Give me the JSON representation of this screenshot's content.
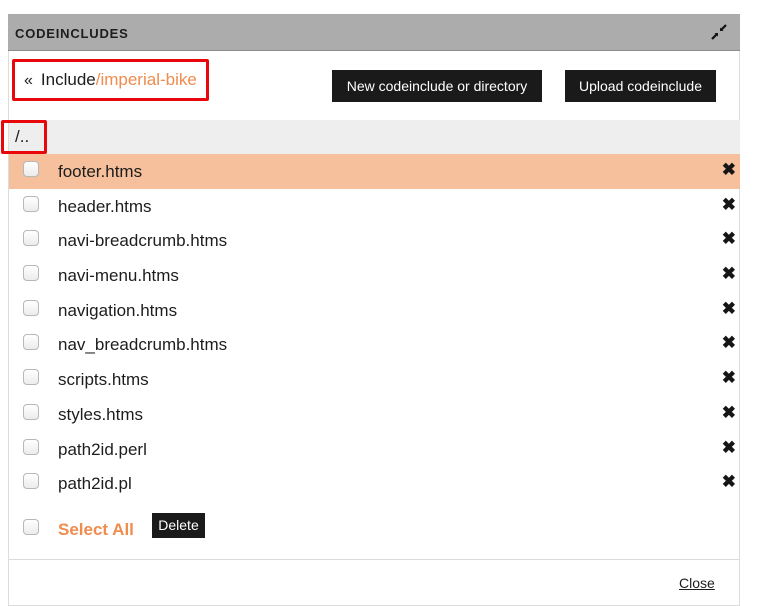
{
  "dialog": {
    "title": "CODEINCLUDES",
    "collapse_icon": "collapse-arrows-icon"
  },
  "breadcrumb": {
    "back_icon": "«",
    "root": "Include",
    "current": "/imperial-bike"
  },
  "toolbar": {
    "new_label": "New codeinclude or directory",
    "upload_label": "Upload codeinclude"
  },
  "parent_dir": {
    "label": "/.."
  },
  "files": [
    {
      "name": "footer.htms",
      "selected": true,
      "checked": false
    },
    {
      "name": "header.htms",
      "selected": false,
      "checked": false
    },
    {
      "name": "navi-breadcrumb.htms",
      "selected": false,
      "checked": false
    },
    {
      "name": "navi-menu.htms",
      "selected": false,
      "checked": false
    },
    {
      "name": "navigation.htms",
      "selected": false,
      "checked": false
    },
    {
      "name": "nav_breadcrumb.htms",
      "selected": false,
      "checked": false
    },
    {
      "name": "scripts.htms",
      "selected": false,
      "checked": false
    },
    {
      "name": "styles.htms",
      "selected": false,
      "checked": false
    },
    {
      "name": "path2id.perl",
      "selected": false,
      "checked": false
    },
    {
      "name": "path2id.pl",
      "selected": false,
      "checked": false
    }
  ],
  "delete_icon": "✖",
  "footer": {
    "select_all_label": "Select All",
    "delete_label": "Delete",
    "close_label": "Close"
  },
  "colors": {
    "accent": "#ef8c4e",
    "selected_row": "#f5c09b",
    "highlight_box": "#e8080c",
    "titlebar": "#acacac",
    "button": "#1a1a1a"
  }
}
